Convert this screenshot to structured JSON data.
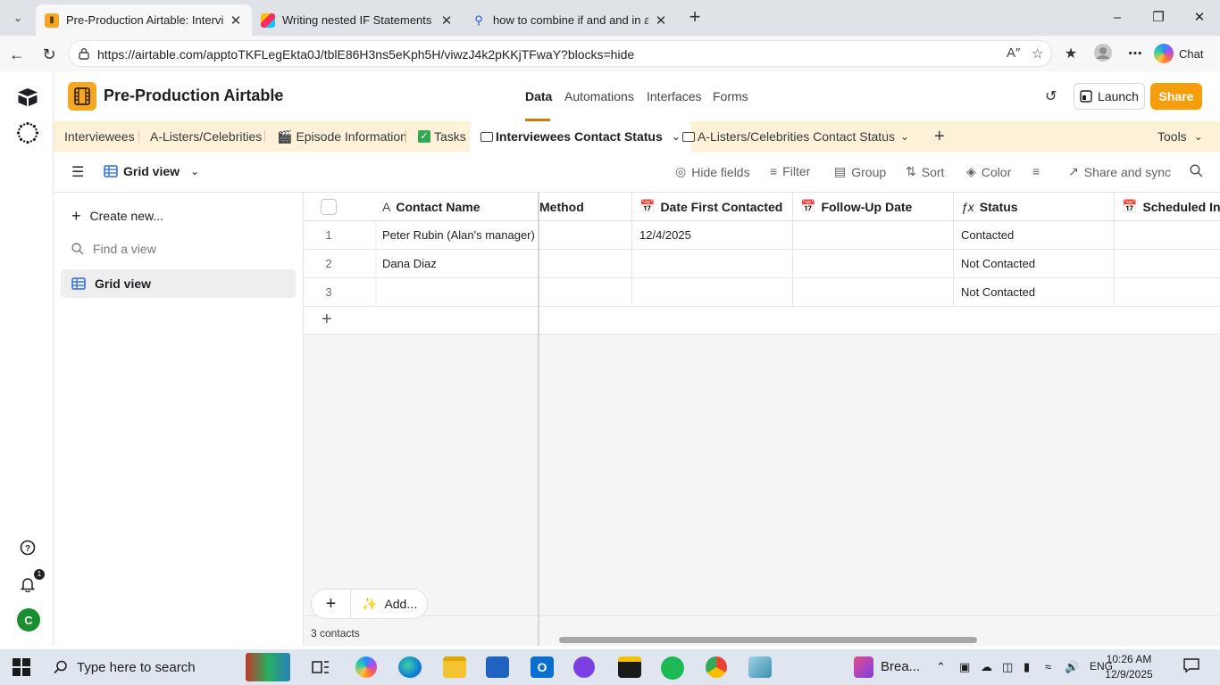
{
  "browser": {
    "tabs": [
      {
        "title": "Pre-Production Airtable: Intervi",
        "active": true
      },
      {
        "title": "Writing nested IF Statements | Airt",
        "active": false
      },
      {
        "title": "how to combine if and and in airta",
        "active": false
      }
    ],
    "url": "https://airtable.com/apptoTKFLegEkta0J/tblE86H3ns5eKph5H/viwzJ4k2pKKjTFwaY?blocks=hide",
    "chat_label": "Chat"
  },
  "app": {
    "base_name": "Pre-Production Airtable",
    "nav": [
      "Data",
      "Automations",
      "Interfaces",
      "Forms"
    ],
    "launch_label": "Launch",
    "share_label": "Share",
    "brand_color": "#f5a623"
  },
  "table_tabs": {
    "items": [
      "Interviewees",
      "A-Listers/Celebrities",
      "Episode Information",
      "Tasks",
      "Interviewees Contact Status",
      "A-Listers/Celebrities Contact Status"
    ],
    "tools_label": "Tools"
  },
  "toolbar": {
    "view_name": "Grid view",
    "hide_fields": "Hide fields",
    "filter": "Filter",
    "group": "Group",
    "sort": "Sort",
    "color": "Color",
    "share_sync": "Share and sync"
  },
  "sidebar": {
    "create_new": "Create new...",
    "find_placeholder": "Find a view",
    "views": [
      "Grid view"
    ]
  },
  "grid": {
    "columns": [
      "Contact Name",
      "Method",
      "Date First Contacted",
      "Follow-Up Date",
      "Status",
      "Scheduled Inte"
    ],
    "rows": [
      {
        "num": "1",
        "name": "Peter Rubin (Alan's manager)",
        "method": "",
        "date_first": "12/4/2025",
        "followup": "",
        "status": "Contacted"
      },
      {
        "num": "2",
        "name": "Dana Diaz",
        "method": "",
        "date_first": "",
        "followup": "",
        "status": "Not Contacted"
      },
      {
        "num": "3",
        "name": "",
        "method": "",
        "date_first": "",
        "followup": "",
        "status": "Not Contacted"
      }
    ],
    "add_label": "Add...",
    "record_count": "3 contacts"
  },
  "rail": {
    "notification_count": "1",
    "avatar_letter": "C"
  },
  "taskbar": {
    "search_placeholder": "Type here to search",
    "running_app": "Brea...",
    "language": "ENG",
    "time": "10:26 AM",
    "date": "12/9/2025"
  }
}
